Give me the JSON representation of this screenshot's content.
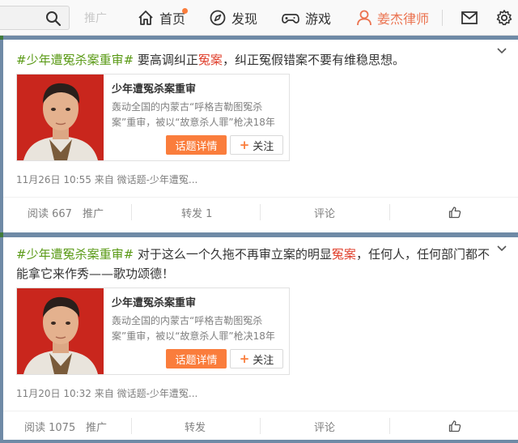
{
  "nav": {
    "search_icon": "search-icon",
    "faint_label": "推广",
    "home": "首页",
    "discover": "发现",
    "game": "游戏",
    "profile": "姜杰律师",
    "accent": "#eb7350"
  },
  "posts": [
    {
      "tag": "#少年遭冤杀案重审#",
      "text_before": " 要高调纠正",
      "highlight": "冤案",
      "text_after": "，纠正冤假错案不要有维稳思想。",
      "topic": {
        "title": "少年遭冤杀案重审",
        "desc": "轰动全国的内蒙古“呼格吉勒图冤杀案”重审，被以“故意杀人罪”枪决18年",
        "detail_button": "话题详情",
        "follow_button": "关注"
      },
      "meta": "11月26日 10:55 来自 微话题-少年遭冤...",
      "actions": {
        "read": "阅读 667",
        "promote": "推广",
        "repost": "转发 1",
        "comment": "评论"
      }
    },
    {
      "tag": "#少年遭冤杀案重审#",
      "text_before": " 对于这么一个久拖不再审立案的明显",
      "highlight": "冤案",
      "text_after": "，任何人，任何部门都不能拿它来作秀——歌功颂德！",
      "topic": {
        "title": "少年遭冤杀案重审",
        "desc": "轰动全国的内蒙古“呼格吉勒图冤杀案”重审，被以“故意杀人罪”枪决18年",
        "detail_button": "话题详情",
        "follow_button": "关注"
      },
      "meta": "11月20日 10:32 来自 微话题-少年遭冤...",
      "actions": {
        "read": "阅读 1075",
        "promote": "推广",
        "repost": "转发",
        "comment": "评论"
      }
    }
  ],
  "colors": {
    "tag": "#5a9a16",
    "highlight": "#e0422f",
    "button": "#fa7d3c"
  }
}
